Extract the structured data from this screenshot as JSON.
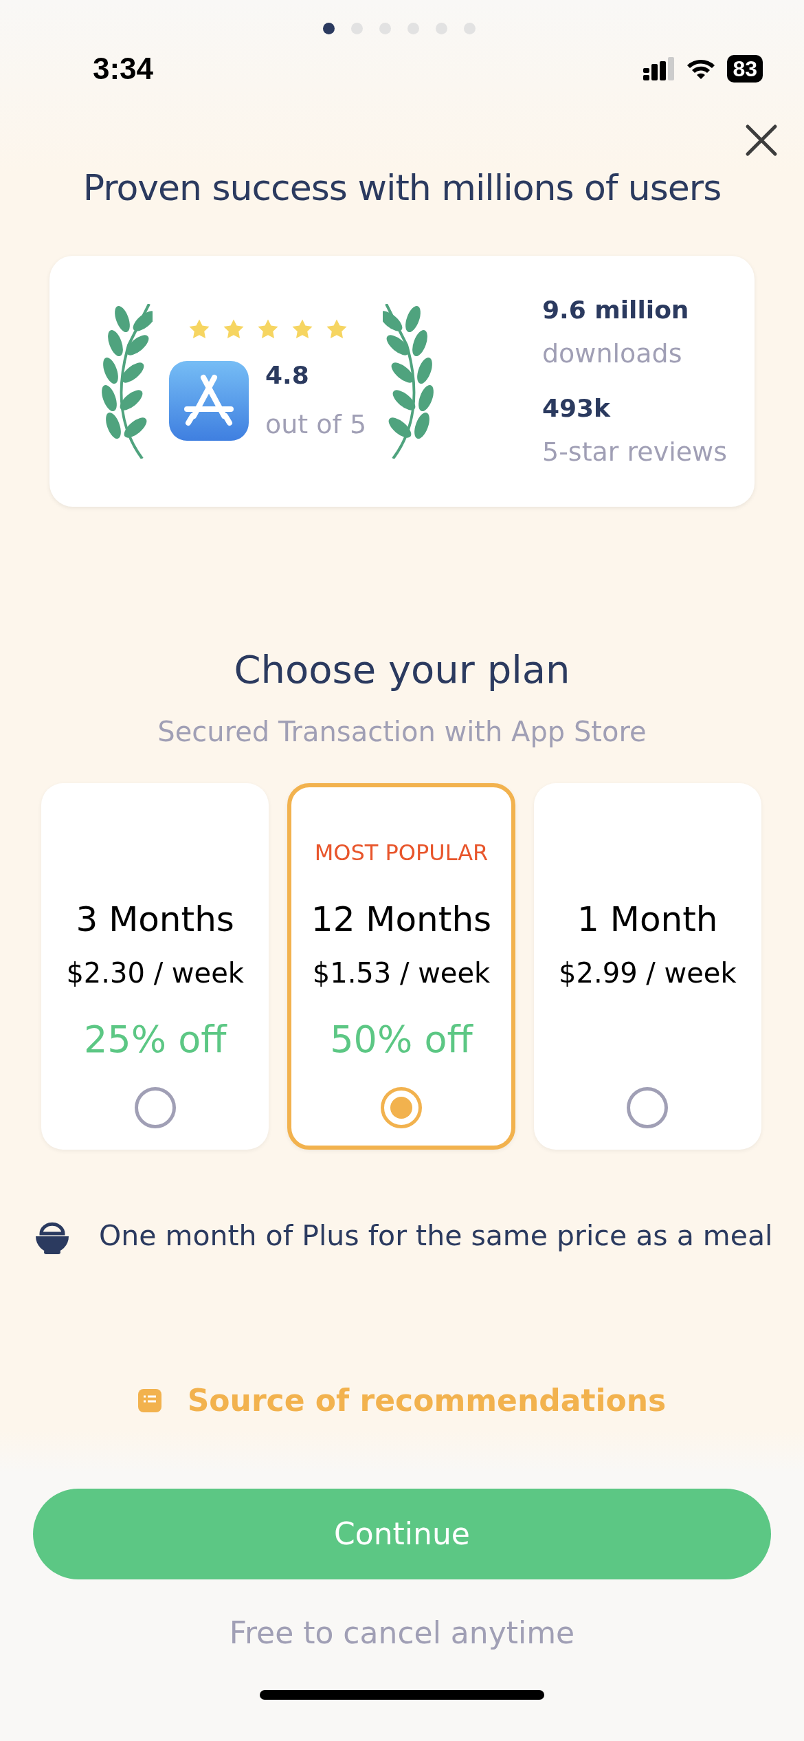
{
  "status_bar": {
    "time": "3:34",
    "battery": "83"
  },
  "page_dots": [
    {
      "selected": true
    },
    {
      "selected": false
    },
    {
      "selected": false
    },
    {
      "selected": false
    },
    {
      "selected": false
    },
    {
      "selected": false
    }
  ],
  "title": "Proven success with millions of users",
  "rating_card": {
    "stars": 5,
    "rating": "4.8",
    "rating_label": "out of 5",
    "stats": [
      {
        "value": "9.6 million",
        "label": "downloads"
      },
      {
        "value": "493k",
        "label": "5-star reviews"
      }
    ]
  },
  "plan_heading": "Choose your plan",
  "plan_subheading": "Secured Transaction with App Store",
  "plans": [
    {
      "name": "3 Months",
      "price": "$2.30 / week",
      "discount": "25% off",
      "selected": false
    },
    {
      "badge": "MOST POPULAR",
      "name": "12 Months",
      "price": "$1.53 / week",
      "discount": "50% off",
      "selected": true
    },
    {
      "name": "1 Month",
      "price": "$2.99 / week",
      "selected": false
    }
  ],
  "feature": "One month of Plus for the same price as a meal",
  "source_link": "Source of recommendations",
  "continue_button": "Continue",
  "footnote": "Free to cancel anytime"
}
